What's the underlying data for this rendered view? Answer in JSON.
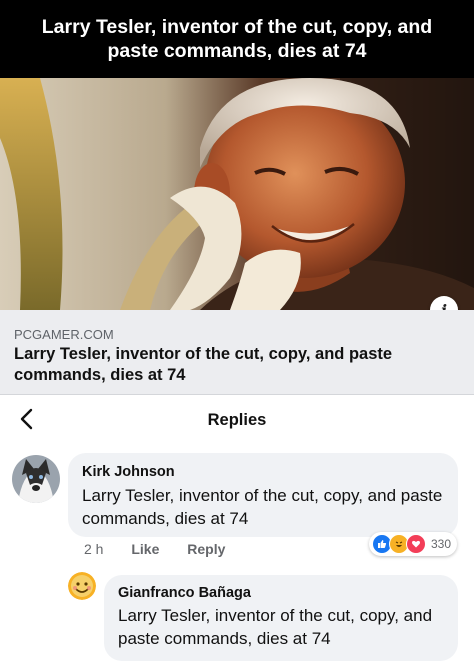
{
  "header": {
    "title": "Larry Tesler, inventor of the cut, copy, and paste commands, dies at 74"
  },
  "link_preview": {
    "domain": "PCGAMER.COM",
    "title": "Larry Tesler, inventor of the cut, copy, and paste commands, dies at 74"
  },
  "replies_bar": {
    "title": "Replies"
  },
  "comments": [
    {
      "author": "Kirk Johnson",
      "text": "Larry Tesler, inventor of the cut, copy, and paste commands, dies at 74",
      "time": "2 h",
      "like_label": "Like",
      "reply_label": "Reply",
      "reaction_count": "330",
      "reactions": [
        "like-icon",
        "haha-icon",
        "love-icon"
      ]
    },
    {
      "author": "Gianfranco Bañaga",
      "text": "Larry Tesler, inventor of the cut, copy, and paste commands, dies at 74"
    }
  ],
  "colors": {
    "like": "#1877f2",
    "love": "#f33e58",
    "haha": "#f7b125",
    "bubble": "#f0f2f5",
    "link_card": "#ecedf0"
  }
}
